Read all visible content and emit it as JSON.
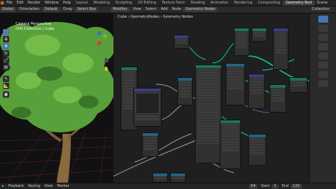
{
  "topbar": {
    "menus": [
      "File",
      "Edit",
      "Render",
      "Window",
      "Help"
    ],
    "workspaces": [
      "Layout",
      "Modeling",
      "Sculpting",
      "UV Editing",
      "Texture Paint",
      "Shading",
      "Animation",
      "Rendering",
      "Compositing",
      "Geometry Nod"
    ],
    "active_workspace_index": 9,
    "scene_label": "Scene"
  },
  "viewport_header": {
    "orientation_label": "Orientation:",
    "orientation_value": "Default",
    "drag_label": "Drag:",
    "drag_value": "Select Box",
    "mode": "Global"
  },
  "node_header": {
    "editor": "Modifier",
    "menus": [
      "View",
      "Select",
      "Add",
      "Node"
    ],
    "tree_name": "Geometry Nodes"
  },
  "breadcrumb": {
    "object": "Cube",
    "modifier": "GeometryNodes",
    "group": "Geometry Nodes"
  },
  "viewport_overlay": {
    "title": "Camera Perspective",
    "subtitle": "(54) Collection | Cube"
  },
  "outliner": {
    "item": "Collection"
  },
  "timeline": {
    "playback_label": "Playback",
    "keying_label": "Keying",
    "view_label": "View",
    "marker_label": "Marker",
    "current_frame": "54",
    "start_label": "Start",
    "start_value": "1",
    "end_label": "End",
    "end_value": "120"
  },
  "colors": {
    "accent": "#4772b3",
    "geometry_socket": "#00d6a3",
    "float_socket": "#a1a1a1",
    "vector_socket": "#6363c7",
    "node_header_green": "#1d725e",
    "node_header_blue": "#3c3c83",
    "node_header_teal": "#246283",
    "leaf_green": "#58a03a",
    "grid_magenta": "#8a1f6f"
  },
  "icons": [
    "blender-logo-icon",
    "select-icon",
    "cursor-icon",
    "move-icon",
    "rotate-icon",
    "scale-icon",
    "transform-icon",
    "annotate-icon",
    "measure-icon",
    "play-icon",
    "camera-icon",
    "hand-icon"
  ]
}
